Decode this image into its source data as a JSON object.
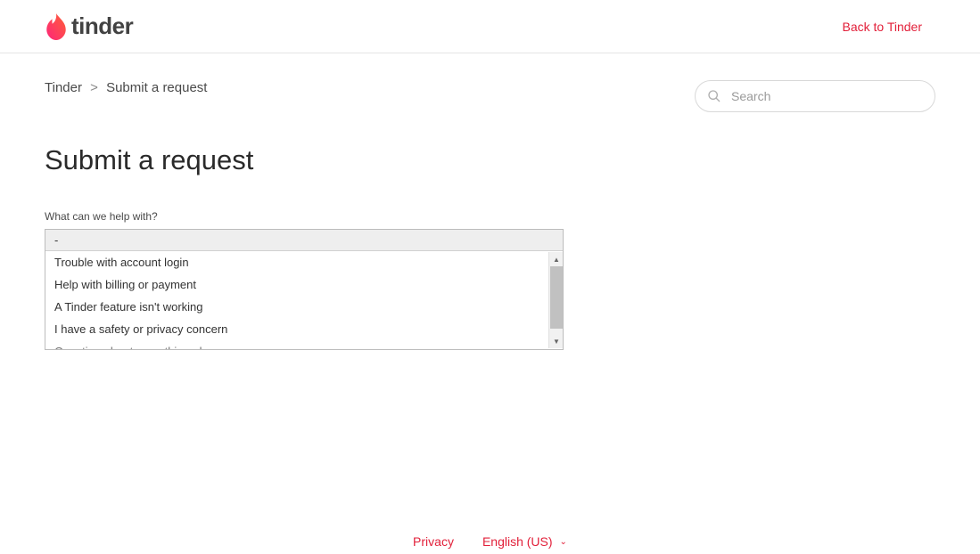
{
  "header": {
    "brand": "tinder",
    "back_link": "Back to Tinder"
  },
  "breadcrumb": {
    "root": "Tinder",
    "separator": ">",
    "current": "Submit a request"
  },
  "search": {
    "placeholder": "Search"
  },
  "page": {
    "title": "Submit a request"
  },
  "form": {
    "help_label": "What can we help with?",
    "selected": "-",
    "options": [
      "Trouble with account login",
      "Help with billing or payment",
      "A Tinder feature isn't working",
      "I have a safety or privacy concern",
      "Question about something else"
    ]
  },
  "footer": {
    "privacy": "Privacy",
    "language": "English (US)"
  }
}
